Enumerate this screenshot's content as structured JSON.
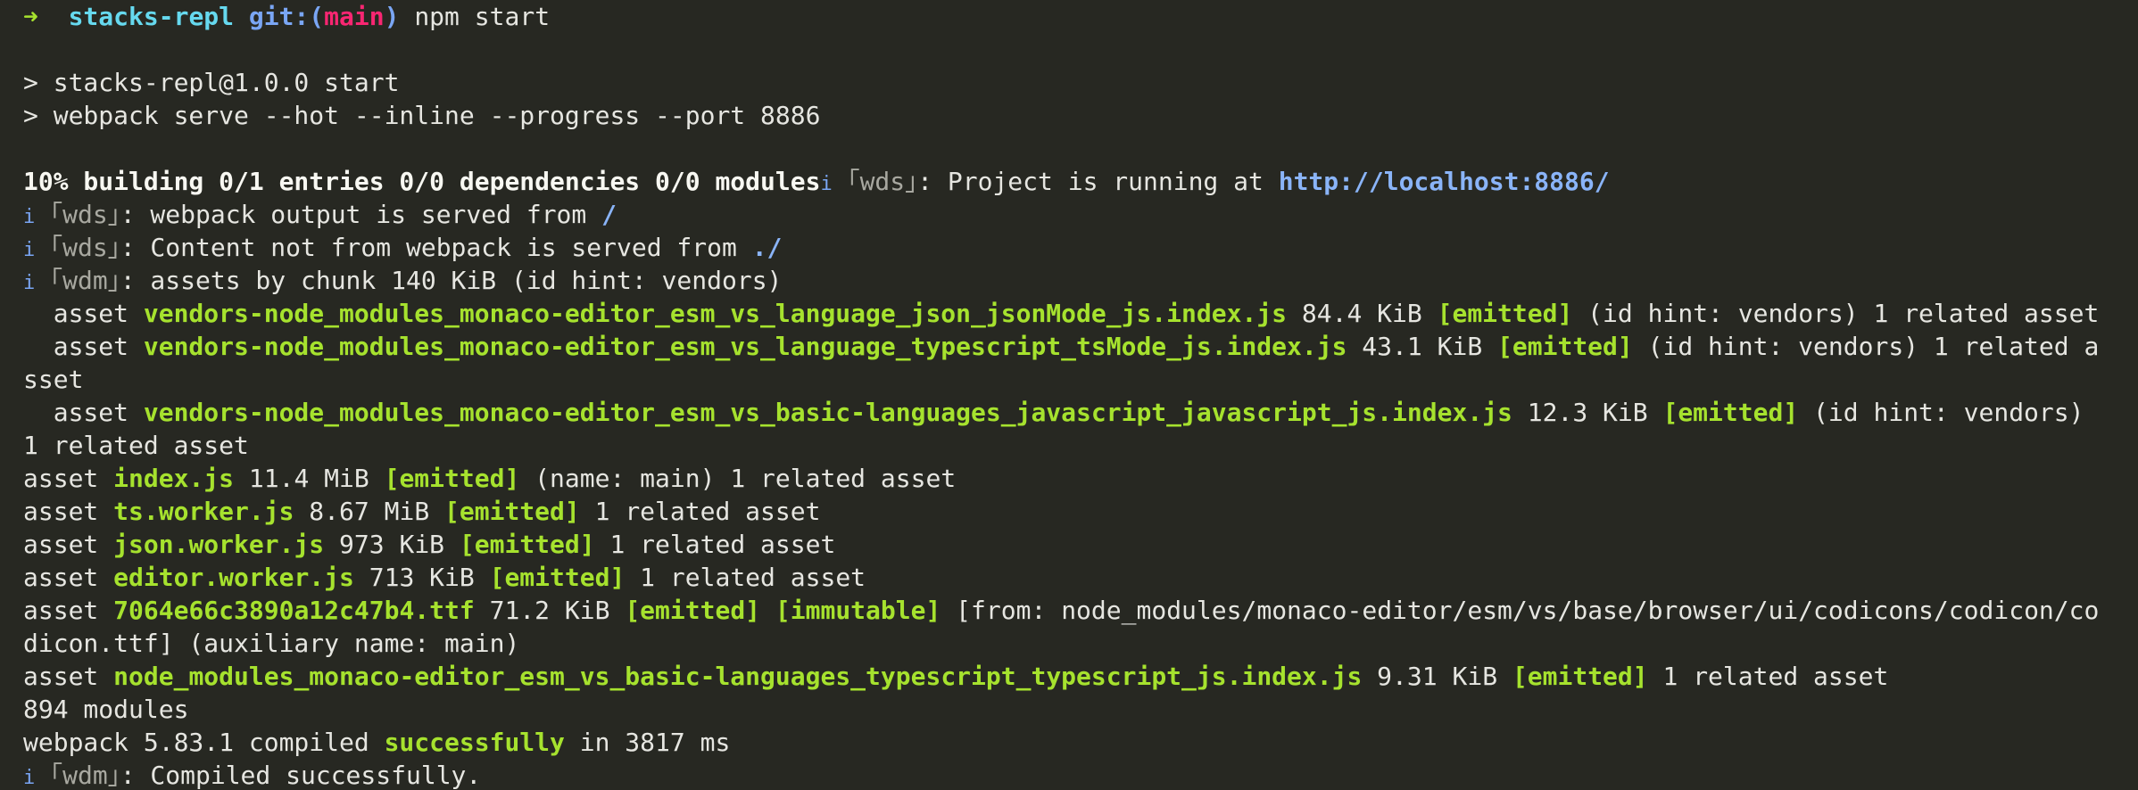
{
  "prompt": {
    "arrow": "➜",
    "dir": "stacks-repl",
    "git_label": "git:(",
    "branch": "main",
    "git_close": ")",
    "command": "npm start"
  },
  "script": {
    "line1": "> stacks-repl@1.0.0 start",
    "line2": "> webpack serve --hot --inline --progress --port 8886"
  },
  "progress": {
    "text": "10% building 0/1 entries 0/0 dependencies 0/0 modules",
    "info_icon": "i",
    "tag": "｢wds｣",
    "msg": ": Project is running at ",
    "url": "http://localhost:8886/"
  },
  "wds": [
    {
      "icon": "i",
      "tag": "｢wds｣",
      "msg": ": webpack output is served from ",
      "path": "/"
    },
    {
      "icon": "i",
      "tag": "｢wds｣",
      "msg": ": Content not from webpack is served from ",
      "path": "./"
    }
  ],
  "wdm_assets": {
    "icon": "i",
    "tag": "｢wdm｣",
    "msg": ": assets by chunk 140 KiB (id hint: vendors)"
  },
  "vendor_assets": [
    {
      "prefix": "  asset ",
      "name": "vendors-node_modules_monaco-editor_esm_vs_language_json_jsonMode_js.index.js",
      "size": " 84.4 KiB ",
      "flag": "[emitted]",
      "rest": " (id hint: vendors) 1 related asset",
      "wrap": ""
    },
    {
      "prefix": "  asset ",
      "name": "vendors-node_modules_monaco-editor_esm_vs_language_typescript_tsMode_js.index.js",
      "size": " 43.1 KiB ",
      "flag": "[emitted]",
      "rest": " (id hint: vendors) 1 related a",
      "wrap": "sset"
    },
    {
      "prefix": "  asset ",
      "name": "vendors-node_modules_monaco-editor_esm_vs_basic-languages_javascript_javascript_js.index.js",
      "size": " 12.3 KiB ",
      "flag": "[emitted]",
      "rest": " (id hint: vendors)",
      "wrap": "1 related asset"
    }
  ],
  "assets": [
    {
      "prefix": "asset ",
      "name": "index.js",
      "size": " 11.4 MiB ",
      "flag": "[emitted]",
      "rest": " (name: main) 1 related asset"
    },
    {
      "prefix": "asset ",
      "name": "ts.worker.js",
      "size": " 8.67 MiB ",
      "flag": "[emitted]",
      "rest": " 1 related asset"
    },
    {
      "prefix": "asset ",
      "name": "json.worker.js",
      "size": " 973 KiB ",
      "flag": "[emitted]",
      "rest": " 1 related asset"
    },
    {
      "prefix": "asset ",
      "name": "editor.worker.js",
      "size": " 713 KiB ",
      "flag": "[emitted]",
      "rest": " 1 related asset"
    }
  ],
  "ttf_asset": {
    "prefix": "asset ",
    "name": "7064e66c3890a12c47b4.ttf",
    "size": " 71.2 KiB ",
    "flag1": "[emitted]",
    "space": " ",
    "flag2": "[immutable]",
    "rest": " [from: node_modules/monaco-editor/esm/vs/base/browser/ui/codicons/codicon/co",
    "wrap": "dicon.ttf] (auxiliary name: main)"
  },
  "ts_asset": {
    "prefix": "asset ",
    "name": "node_modules_monaco-editor_esm_vs_basic-languages_typescript_typescript_js.index.js",
    "size": " 9.31 KiB ",
    "flag": "[emitted]",
    "rest": " 1 related asset"
  },
  "modules": "894 modules",
  "compiled": {
    "prefix": "webpack 5.83.1 compiled ",
    "status": "successfully",
    "suffix": " in 3817 ms"
  },
  "wdm_done": {
    "icon": "i",
    "tag": "｢wdm｣",
    "msg": ": Compiled successfully."
  }
}
